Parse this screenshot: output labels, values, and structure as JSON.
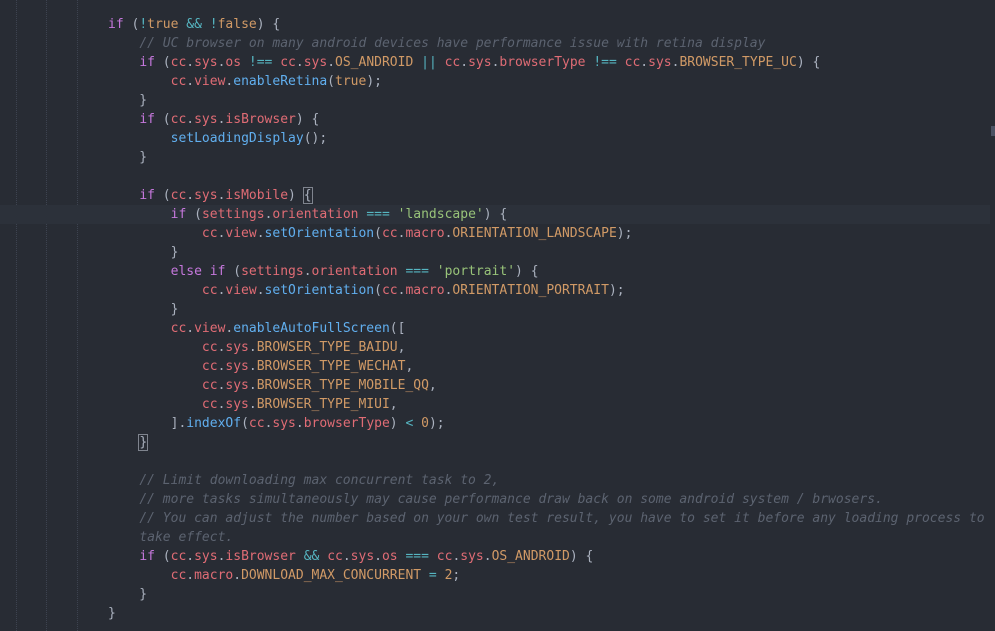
{
  "editor": {
    "colors": {
      "background": "#282c34",
      "keyword": "#c678dd",
      "variable": "#e06c75",
      "function": "#61afef",
      "comment": "#5c6370",
      "string": "#98c379",
      "number": "#d19a66",
      "operator": "#56b6c2",
      "punctuation": "#abb2bf"
    },
    "current_line": 10,
    "lines": [
      [
        [
          "k",
          "if"
        ],
        [
          "p",
          " ("
        ],
        [
          "o",
          "!"
        ],
        [
          "n",
          "true"
        ],
        [
          "p",
          " "
        ],
        [
          "o",
          "&&"
        ],
        [
          "p",
          " "
        ],
        [
          "o",
          "!"
        ],
        [
          "n",
          "false"
        ],
        [
          "p",
          ") {"
        ]
      ],
      [
        [
          "p",
          "    "
        ],
        [
          "c",
          "// UC browser on many android devices have performance issue with retina display"
        ]
      ],
      [
        [
          "p",
          "    "
        ],
        [
          "k",
          "if"
        ],
        [
          "p",
          " ("
        ],
        [
          "v",
          "cc"
        ],
        [
          "p",
          "."
        ],
        [
          "v",
          "sys"
        ],
        [
          "p",
          "."
        ],
        [
          "v",
          "os"
        ],
        [
          "p",
          " "
        ],
        [
          "o",
          "!=="
        ],
        [
          "p",
          " "
        ],
        [
          "v",
          "cc"
        ],
        [
          "p",
          "."
        ],
        [
          "v",
          "sys"
        ],
        [
          "p",
          "."
        ],
        [
          "n",
          "OS_ANDROID"
        ],
        [
          "p",
          " "
        ],
        [
          "o",
          "||"
        ],
        [
          "p",
          " "
        ],
        [
          "v",
          "cc"
        ],
        [
          "p",
          "."
        ],
        [
          "v",
          "sys"
        ],
        [
          "p",
          "."
        ],
        [
          "v",
          "browserType"
        ],
        [
          "p",
          " "
        ],
        [
          "o",
          "!=="
        ],
        [
          "p",
          " "
        ],
        [
          "v",
          "cc"
        ],
        [
          "p",
          "."
        ],
        [
          "v",
          "sys"
        ],
        [
          "p",
          "."
        ],
        [
          "n",
          "BROWSER_TYPE_UC"
        ],
        [
          "p",
          ") {"
        ]
      ],
      [
        [
          "p",
          "        "
        ],
        [
          "v",
          "cc"
        ],
        [
          "p",
          "."
        ],
        [
          "v",
          "view"
        ],
        [
          "p",
          "."
        ],
        [
          "f",
          "enableRetina"
        ],
        [
          "p",
          "("
        ],
        [
          "n",
          "true"
        ],
        [
          "p",
          ");"
        ]
      ],
      [
        [
          "p",
          "    }"
        ]
      ],
      [
        [
          "p",
          "    "
        ],
        [
          "k",
          "if"
        ],
        [
          "p",
          " ("
        ],
        [
          "v",
          "cc"
        ],
        [
          "p",
          "."
        ],
        [
          "v",
          "sys"
        ],
        [
          "p",
          "."
        ],
        [
          "v",
          "isBrowser"
        ],
        [
          "p",
          ") {"
        ]
      ],
      [
        [
          "p",
          "        "
        ],
        [
          "f",
          "setLoadingDisplay"
        ],
        [
          "p",
          "();"
        ]
      ],
      [
        [
          "p",
          "    }"
        ]
      ],
      [],
      [
        [
          "p",
          "    "
        ],
        [
          "k",
          "if"
        ],
        [
          "p",
          " ("
        ],
        [
          "v",
          "cc"
        ],
        [
          "p",
          "."
        ],
        [
          "v",
          "sys"
        ],
        [
          "p",
          "."
        ],
        [
          "v",
          "isMobile"
        ],
        [
          "p",
          ") "
        ],
        [
          "bm",
          "{"
        ]
      ],
      [
        [
          "p",
          "        "
        ],
        [
          "k",
          "if"
        ],
        [
          "p",
          " ("
        ],
        [
          "v",
          "settings"
        ],
        [
          "p",
          "."
        ],
        [
          "v",
          "orientation"
        ],
        [
          "p",
          " "
        ],
        [
          "o",
          "==="
        ],
        [
          "p",
          " "
        ],
        [
          "s",
          "'landscape'"
        ],
        [
          "p",
          ") {"
        ]
      ],
      [
        [
          "p",
          "            "
        ],
        [
          "v",
          "cc"
        ],
        [
          "p",
          "."
        ],
        [
          "v",
          "view"
        ],
        [
          "p",
          "."
        ],
        [
          "f",
          "setOrientation"
        ],
        [
          "p",
          "("
        ],
        [
          "v",
          "cc"
        ],
        [
          "p",
          "."
        ],
        [
          "v",
          "macro"
        ],
        [
          "p",
          "."
        ],
        [
          "n",
          "ORIENTATION_LANDSCAPE"
        ],
        [
          "p",
          ");"
        ]
      ],
      [
        [
          "p",
          "        }"
        ]
      ],
      [
        [
          "p",
          "        "
        ],
        [
          "k",
          "else"
        ],
        [
          "p",
          " "
        ],
        [
          "k",
          "if"
        ],
        [
          "p",
          " ("
        ],
        [
          "v",
          "settings"
        ],
        [
          "p",
          "."
        ],
        [
          "v",
          "orientation"
        ],
        [
          "p",
          " "
        ],
        [
          "o",
          "==="
        ],
        [
          "p",
          " "
        ],
        [
          "s",
          "'portrait'"
        ],
        [
          "p",
          ") {"
        ]
      ],
      [
        [
          "p",
          "            "
        ],
        [
          "v",
          "cc"
        ],
        [
          "p",
          "."
        ],
        [
          "v",
          "view"
        ],
        [
          "p",
          "."
        ],
        [
          "f",
          "setOrientation"
        ],
        [
          "p",
          "("
        ],
        [
          "v",
          "cc"
        ],
        [
          "p",
          "."
        ],
        [
          "v",
          "macro"
        ],
        [
          "p",
          "."
        ],
        [
          "n",
          "ORIENTATION_PORTRAIT"
        ],
        [
          "p",
          ");"
        ]
      ],
      [
        [
          "p",
          "        }"
        ]
      ],
      [
        [
          "p",
          "        "
        ],
        [
          "v",
          "cc"
        ],
        [
          "p",
          "."
        ],
        [
          "v",
          "view"
        ],
        [
          "p",
          "."
        ],
        [
          "f",
          "enableAutoFullScreen"
        ],
        [
          "p",
          "(["
        ]
      ],
      [
        [
          "p",
          "            "
        ],
        [
          "v",
          "cc"
        ],
        [
          "p",
          "."
        ],
        [
          "v",
          "sys"
        ],
        [
          "p",
          "."
        ],
        [
          "n",
          "BROWSER_TYPE_BAIDU"
        ],
        [
          "p",
          ","
        ]
      ],
      [
        [
          "p",
          "            "
        ],
        [
          "v",
          "cc"
        ],
        [
          "p",
          "."
        ],
        [
          "v",
          "sys"
        ],
        [
          "p",
          "."
        ],
        [
          "n",
          "BROWSER_TYPE_WECHAT"
        ],
        [
          "p",
          ","
        ]
      ],
      [
        [
          "p",
          "            "
        ],
        [
          "v",
          "cc"
        ],
        [
          "p",
          "."
        ],
        [
          "v",
          "sys"
        ],
        [
          "p",
          "."
        ],
        [
          "n",
          "BROWSER_TYPE_MOBILE_QQ"
        ],
        [
          "p",
          ","
        ]
      ],
      [
        [
          "p",
          "            "
        ],
        [
          "v",
          "cc"
        ],
        [
          "p",
          "."
        ],
        [
          "v",
          "sys"
        ],
        [
          "p",
          "."
        ],
        [
          "n",
          "BROWSER_TYPE_MIUI"
        ],
        [
          "p",
          ","
        ]
      ],
      [
        [
          "p",
          "        ]."
        ],
        [
          "f",
          "indexOf"
        ],
        [
          "p",
          "("
        ],
        [
          "v",
          "cc"
        ],
        [
          "p",
          "."
        ],
        [
          "v",
          "sys"
        ],
        [
          "p",
          "."
        ],
        [
          "v",
          "browserType"
        ],
        [
          "p",
          ") "
        ],
        [
          "o",
          "<"
        ],
        [
          "p",
          " "
        ],
        [
          "n",
          "0"
        ],
        [
          "p",
          ");"
        ]
      ],
      [
        [
          "p",
          "    "
        ],
        [
          "bm",
          "}"
        ]
      ],
      [],
      [
        [
          "p",
          "    "
        ],
        [
          "c",
          "// Limit downloading max concurrent task to 2,"
        ]
      ],
      [
        [
          "p",
          "    "
        ],
        [
          "c",
          "// more tasks simultaneously may cause performance draw back on some android system / brwosers."
        ]
      ],
      [
        [
          "p",
          "    "
        ],
        [
          "c",
          "// You can adjust the number based on your own test result, you have to set it before any loading process to"
        ]
      ],
      [
        [
          "p",
          "    "
        ],
        [
          "c",
          "take effect."
        ]
      ],
      [
        [
          "p",
          "    "
        ],
        [
          "k",
          "if"
        ],
        [
          "p",
          " ("
        ],
        [
          "v",
          "cc"
        ],
        [
          "p",
          "."
        ],
        [
          "v",
          "sys"
        ],
        [
          "p",
          "."
        ],
        [
          "v",
          "isBrowser"
        ],
        [
          "p",
          " "
        ],
        [
          "o",
          "&&"
        ],
        [
          "p",
          " "
        ],
        [
          "v",
          "cc"
        ],
        [
          "p",
          "."
        ],
        [
          "v",
          "sys"
        ],
        [
          "p",
          "."
        ],
        [
          "v",
          "os"
        ],
        [
          "p",
          " "
        ],
        [
          "o",
          "==="
        ],
        [
          "p",
          " "
        ],
        [
          "v",
          "cc"
        ],
        [
          "p",
          "."
        ],
        [
          "v",
          "sys"
        ],
        [
          "p",
          "."
        ],
        [
          "n",
          "OS_ANDROID"
        ],
        [
          "p",
          ") {"
        ]
      ],
      [
        [
          "p",
          "        "
        ],
        [
          "v",
          "cc"
        ],
        [
          "p",
          "."
        ],
        [
          "v",
          "macro"
        ],
        [
          "p",
          "."
        ],
        [
          "n",
          "DOWNLOAD_MAX_CONCURRENT"
        ],
        [
          "p",
          " "
        ],
        [
          "o",
          "="
        ],
        [
          "p",
          " "
        ],
        [
          "n",
          "2"
        ],
        [
          "p",
          ";"
        ]
      ],
      [
        [
          "p",
          "    }"
        ]
      ],
      [
        [
          "p",
          "}"
        ]
      ]
    ]
  }
}
